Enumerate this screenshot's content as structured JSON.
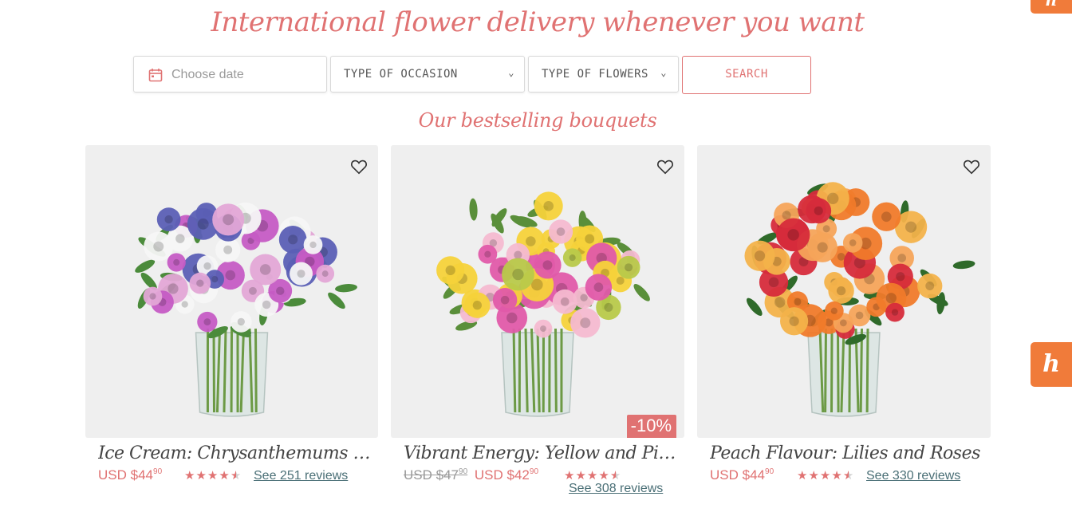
{
  "hero": {
    "title": "International flower delivery whenever you want"
  },
  "search": {
    "date_placeholder": "Choose date",
    "occasion_label": "TYPE OF OCCASION",
    "flowers_label": "TYPE OF FLOWERS",
    "chevron": "⌄",
    "button_label": "SEARCH"
  },
  "section": {
    "title": "Our bestselling bouquets"
  },
  "products": [
    {
      "name": "Ice Cream: Chrysanthemums and...",
      "currency": "USD",
      "price_main": "$44",
      "price_cents": "90",
      "rating": 4.5,
      "reviews_label": "See 251 reviews",
      "palette": [
        "#c55bc4",
        "#f5f5f5",
        "#e3a6d6",
        "#5b5fb5",
        "#4b8b3b"
      ]
    },
    {
      "name": "Vibrant Energy: Yellow and Pink...",
      "currency": "USD",
      "old_price_main": "$47",
      "old_price_cents": "90",
      "price_main": "$42",
      "price_cents": "90",
      "discount": "-10%",
      "rating": 4.5,
      "reviews_label": "See 308 reviews",
      "palette": [
        "#f5d23a",
        "#e05aa9",
        "#f4b9d0",
        "#b8c94a",
        "#5a8f3a"
      ]
    },
    {
      "name": "Peach Flavour: Lilies and Roses",
      "currency": "USD",
      "price_main": "$44",
      "price_cents": "90",
      "rating": 4.5,
      "reviews_label": "See 330 reviews",
      "palette": [
        "#f07a2a",
        "#d62b3b",
        "#f5a45a",
        "#f3b24a",
        "#2f6a2a"
      ]
    }
  ],
  "widgets": {
    "badge_glyph": "h"
  }
}
